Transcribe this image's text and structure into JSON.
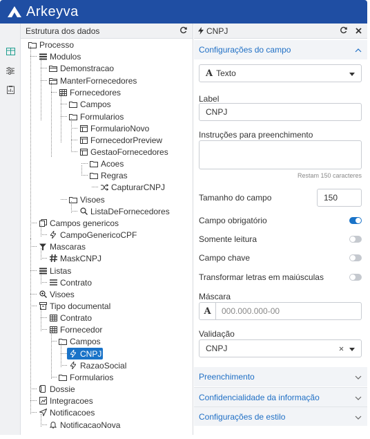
{
  "app": {
    "title": "Arkeyva",
    "brand_color": "#1f4ea3",
    "accent": "#1a73c8"
  },
  "tree_panel": {
    "title": "Estrutura dos dados",
    "nodes": [
      {
        "label": "Processo",
        "icon": "folder-icon"
      },
      {
        "label": "Modulos",
        "icon": "list-icon"
      },
      {
        "label": "Demonstracao",
        "icon": "folder-open-icon"
      },
      {
        "label": "ManterFornecedores",
        "icon": "folder-open-icon"
      },
      {
        "label": "Fornecedores",
        "icon": "table-icon"
      },
      {
        "label": "Campos",
        "icon": "folder-icon"
      },
      {
        "label": "Formularios",
        "icon": "folder-icon"
      },
      {
        "label": "FormularioNovo",
        "icon": "form-icon"
      },
      {
        "label": "FornecedorPreview",
        "icon": "form-icon"
      },
      {
        "label": "GestaoFornecedores",
        "icon": "form-icon"
      },
      {
        "label": "Acoes",
        "icon": "folder-icon"
      },
      {
        "label": "Regras",
        "icon": "folder-icon"
      },
      {
        "label": "CapturarCNPJ",
        "icon": "shuffle-icon"
      },
      {
        "label": "Visoes",
        "icon": "folder-icon"
      },
      {
        "label": "ListaDeFornecedores",
        "icon": "search-icon"
      },
      {
        "label": "Campos genericos",
        "icon": "copy-icon"
      },
      {
        "label": "CampoGenericoCPF",
        "icon": "bolt-icon"
      },
      {
        "label": "Mascaras",
        "icon": "filter-icon"
      },
      {
        "label": "MaskCNPJ",
        "icon": "hash-icon"
      },
      {
        "label": "Listas",
        "icon": "list-icon"
      },
      {
        "label": "Contrato",
        "icon": "lines-icon"
      },
      {
        "label": "Visoes",
        "icon": "zoom-icon"
      },
      {
        "label": "Tipo documental",
        "icon": "archive-icon"
      },
      {
        "label": "Contrato",
        "icon": "table-icon"
      },
      {
        "label": "Fornecedor",
        "icon": "table-icon"
      },
      {
        "label": "Campos",
        "icon": "folder-icon"
      },
      {
        "label": "CNPJ",
        "icon": "bolt-icon"
      },
      {
        "label": "RazaoSocial",
        "icon": "bolt-icon"
      },
      {
        "label": "Formularios",
        "icon": "folder-icon"
      },
      {
        "label": "Dossie",
        "icon": "doc-icon"
      },
      {
        "label": "Integracoes",
        "icon": "integration-icon"
      },
      {
        "label": "Notificacoes",
        "icon": "send-icon"
      },
      {
        "label": "NotificacaoNova",
        "icon": "bell-icon"
      }
    ]
  },
  "props": {
    "title": "CNPJ",
    "config_section": "Configurações do campo",
    "type_value": "Texto",
    "label_label": "Label",
    "label_value": "CNPJ",
    "instr_label": "Instruções para preenchimento",
    "instr_hint": "Restam 150 caracteres",
    "size_label": "Tamanho do campo",
    "size_value": "150",
    "toggles": [
      {
        "label": "Campo obrigatório",
        "on": true
      },
      {
        "label": "Somente leitura",
        "on": false
      },
      {
        "label": "Campo chave",
        "on": false
      },
      {
        "label": "Transformar letras em maiúsculas",
        "on": false
      }
    ],
    "mask_label": "Máscara",
    "mask_placeholder": "000.000.000-00",
    "validation_label": "Validação",
    "validation_value": "CNPJ",
    "sections": [
      "Preenchimento",
      "Confidencialidade da informação",
      "Configurações de estilo"
    ]
  }
}
